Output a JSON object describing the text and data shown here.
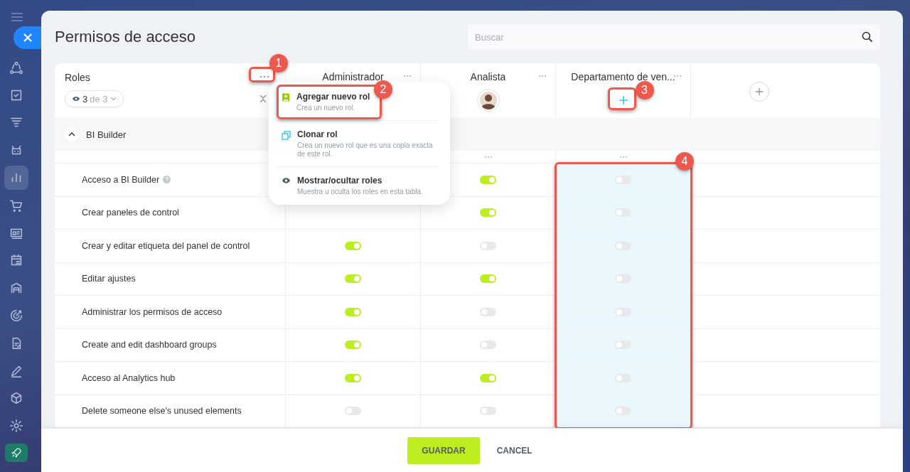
{
  "sidebar": {
    "items": [
      {
        "kind": "nodes",
        "selected": false
      },
      {
        "kind": "check",
        "selected": false
      },
      {
        "kind": "funnel",
        "selected": false
      },
      {
        "kind": "robot",
        "selected": false
      },
      {
        "kind": "chart",
        "selected": true
      },
      {
        "kind": "cart",
        "selected": false
      },
      {
        "kind": "card",
        "selected": false
      },
      {
        "kind": "calendar",
        "selected": false
      },
      {
        "kind": "garage",
        "selected": false
      },
      {
        "kind": "target",
        "selected": false
      },
      {
        "kind": "doc",
        "selected": false
      },
      {
        "kind": "pen",
        "selected": false
      },
      {
        "kind": "box",
        "selected": false
      },
      {
        "kind": "gear",
        "selected": false
      }
    ]
  },
  "title": "Permisos de acceso",
  "search": {
    "placeholder": "Buscar"
  },
  "roles_header": {
    "label": "Roles",
    "count": "3",
    "total": "de 3",
    "annotation": "1"
  },
  "roles": [
    {
      "name": "Administrador",
      "kind": "none",
      "highlighted": false
    },
    {
      "name": "Analista",
      "kind": "avatar",
      "highlighted": false
    },
    {
      "name": "Departamento de ven...",
      "kind": "add",
      "highlighted": true,
      "annotation": "3",
      "column_annotation": "4"
    }
  ],
  "section": {
    "label": "BI Builder",
    "expanded": true
  },
  "permissions": [
    {
      "label": "Acceso a BI Builder",
      "help": true,
      "analista": true,
      "departamento": false
    },
    {
      "label": "Crear paneles de control",
      "help": false,
      "analista": true,
      "departamento": false
    },
    {
      "label": "Crear y editar etiqueta del panel de control",
      "help": false,
      "administrador": true,
      "analista": false,
      "departamento": false
    },
    {
      "label": "Editar ajustes",
      "help": false,
      "administrador": true,
      "analista": true,
      "departamento": false
    },
    {
      "label": "Administrar los permisos de acceso",
      "help": false,
      "administrador": true,
      "analista": false,
      "departamento": false
    },
    {
      "label": "Create and edit dashboard groups",
      "help": false,
      "administrador": true,
      "analista": false,
      "departamento": false
    },
    {
      "label": "Acceso al Analytics hub",
      "help": false,
      "administrador": true,
      "analista": true,
      "departamento": false
    },
    {
      "label": "Delete someone else's unused elements",
      "help": false,
      "administrador": false,
      "analista": false,
      "departamento": false
    }
  ],
  "menu": {
    "items": [
      {
        "kind": "add",
        "title": "Agregar nuevo rol",
        "description": "Crea un nuevo rol.",
        "annotation": "2"
      },
      {
        "kind": "clone",
        "title": "Clonar rol",
        "description": "Crea un nuevo rol que es una copia exacta de este rol."
      },
      {
        "kind": "eye",
        "title": "Mostrar/ocultar roles",
        "description": "Muestra u oculta los roles en esta tabla."
      }
    ]
  },
  "footer": {
    "buttons": [
      {
        "label": "GUARDAR",
        "kind": "primary"
      },
      {
        "label": "CANCEL",
        "kind": "link"
      }
    ]
  }
}
